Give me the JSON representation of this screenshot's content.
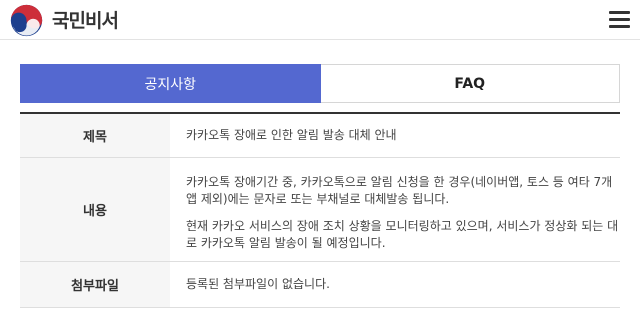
{
  "header": {
    "brand_name": "국민비서",
    "logo_icon": "taegeuk-emblem-icon",
    "menu_icon": "hamburger-menu-icon"
  },
  "tabs": [
    {
      "label": "공지사항",
      "active": true
    },
    {
      "label": "FAQ",
      "active": false
    }
  ],
  "notice": {
    "title_label": "제목",
    "title_value": "카카오톡 장애로 인한 알림 발송 대체 안내",
    "content_label": "내용",
    "content_paragraph_1": "카카오톡 장애기간 중, 카카오톡으로 알림 신청을 한 경우(네이버앱, 토스 등 여타 7개 앱 제외)에는 문자로 또는 부채널로 대체발송 됩니다.",
    "content_paragraph_2": "현재 카카오 서비스의 장애 조치 상황을 모니터링하고 있으며, 서비스가 정상화 되는 대로 카카오톡 알림 발송이 될 예정입니다.",
    "attachment_label": "첨부파일",
    "attachment_value": "등록된 첨부파일이 없습니다."
  },
  "colors": {
    "accent": "#5468d0",
    "emblem_red": "#cd2e3a",
    "emblem_blue": "#1d3f8e"
  }
}
